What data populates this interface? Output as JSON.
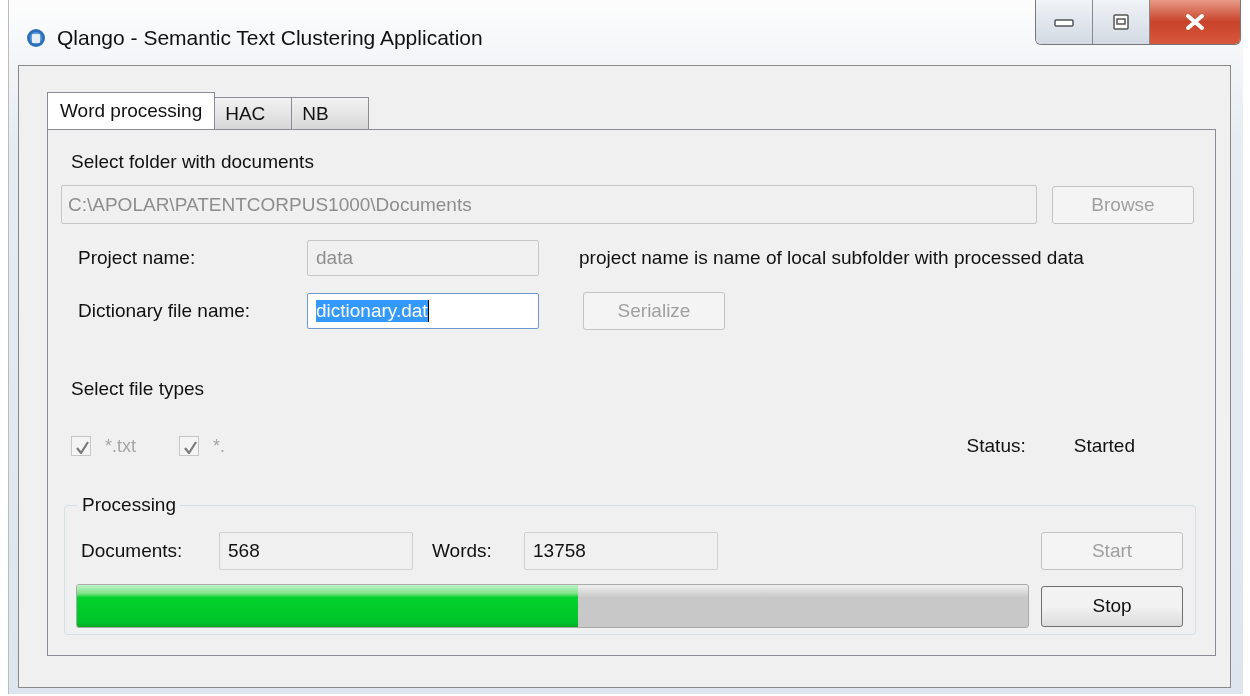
{
  "window": {
    "title": "Qlango - Semantic Text Clustering Application"
  },
  "tabs": [
    {
      "label": "Word processing",
      "selected": true
    },
    {
      "label": "HAC",
      "selected": false
    },
    {
      "label": "NB",
      "selected": false
    }
  ],
  "folder": {
    "label": "Select folder with documents",
    "path": "C:\\APOLAR\\PATENTCORPUS1000\\Documents",
    "disabled": true,
    "browse": {
      "label": "Browse",
      "disabled": true
    }
  },
  "project": {
    "label": "Project name:",
    "value": "data",
    "disabled": true,
    "note": "project name is name of local subfolder with processed data"
  },
  "dictionary": {
    "label": "Dictionary file name:",
    "value": "dictionary.dat",
    "disabled": false,
    "text_selected": true,
    "serialize": {
      "label": "Serialize",
      "disabled": true
    }
  },
  "file_types": {
    "label": "Select file types",
    "options": [
      {
        "label": "*.txt",
        "checked": true,
        "disabled": true
      },
      {
        "label": "*.",
        "checked": true,
        "disabled": true
      }
    ]
  },
  "status": {
    "label": "Status:",
    "value": "Started"
  },
  "processing": {
    "legend": "Processing",
    "documents_label": "Documents:",
    "documents": "568",
    "words_label": "Words:",
    "words": "13758",
    "progress": {
      "level": 0.527
    },
    "buttons": [
      {
        "label": "Start",
        "disabled": true
      },
      {
        "label": "Stop",
        "disabled": false
      }
    ]
  }
}
